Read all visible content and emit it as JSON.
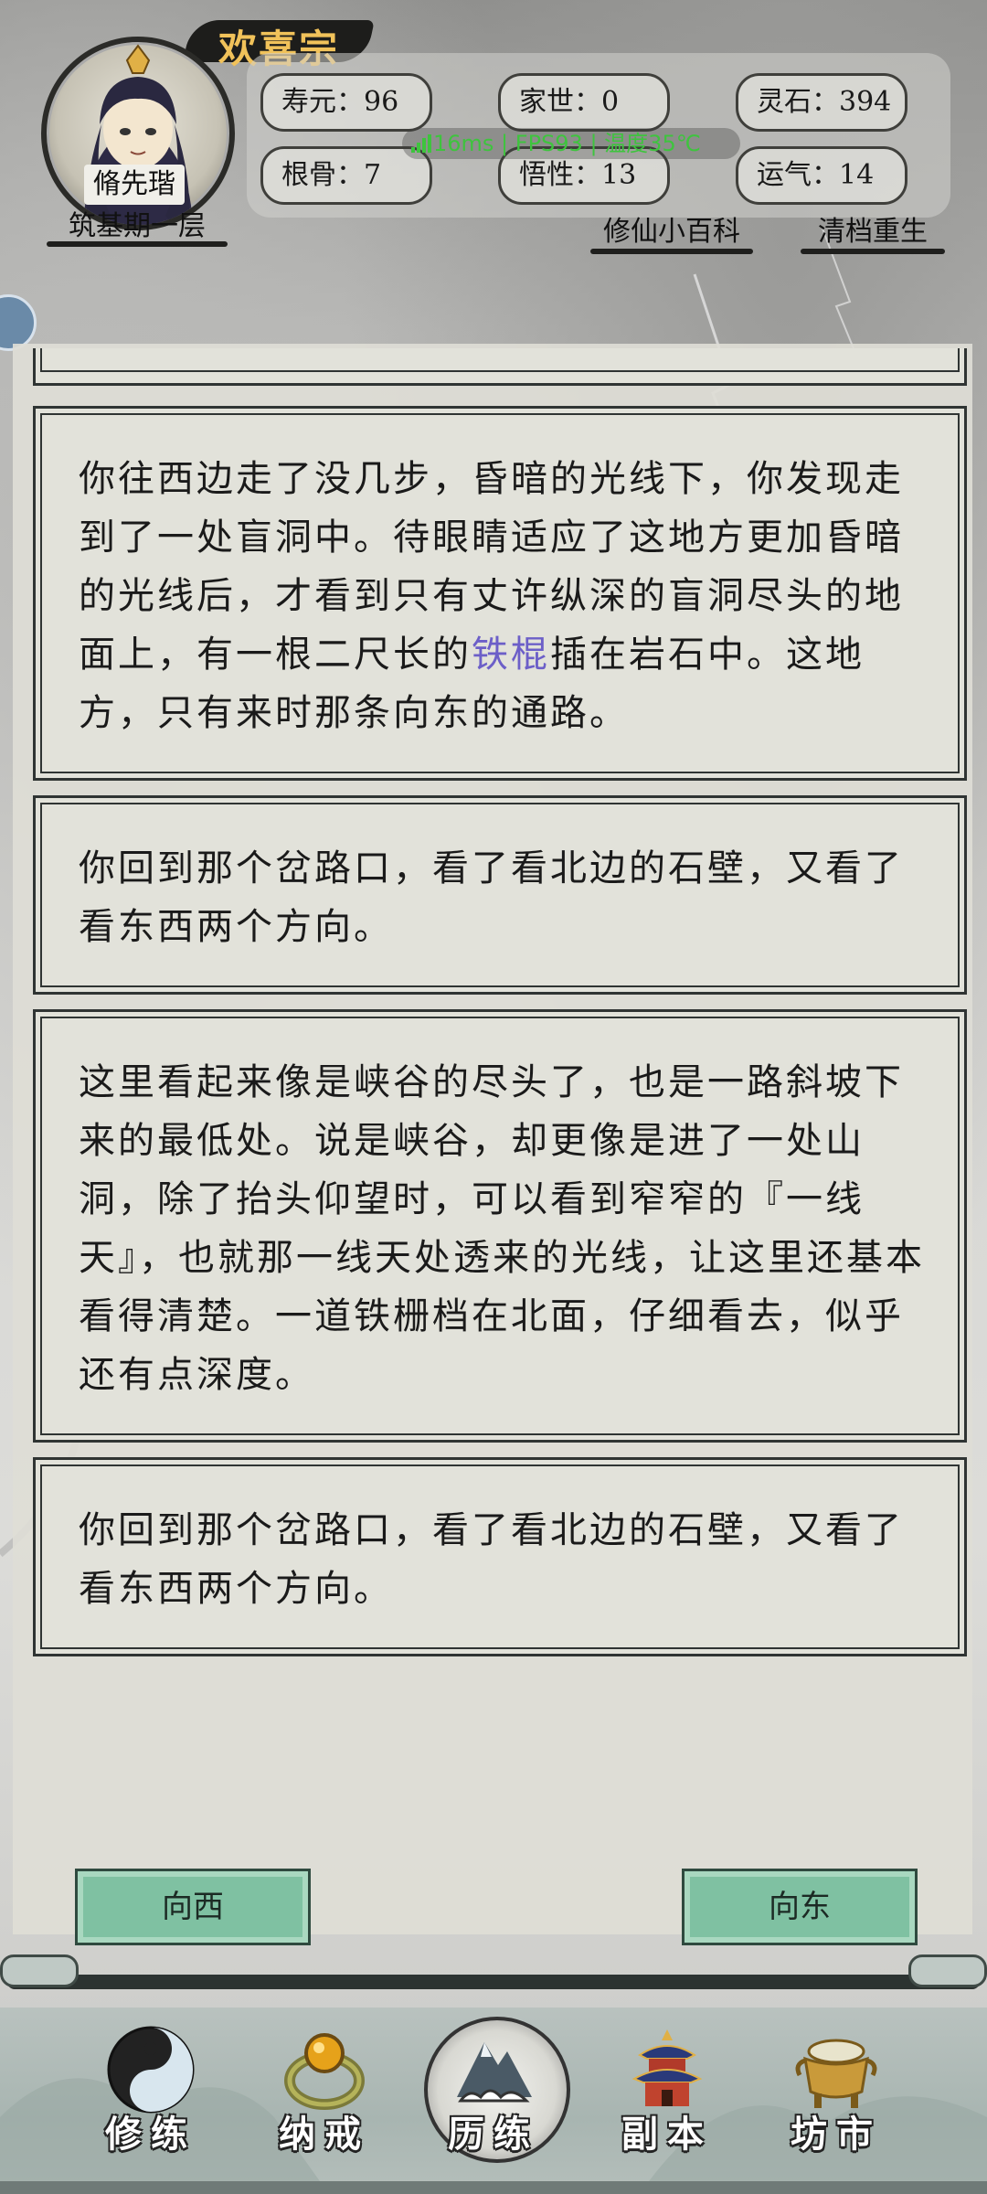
{
  "header": {
    "sect_name": "欢喜宗",
    "character_name": "脩先瑎",
    "realm": "筑基期一层",
    "stats": [
      {
        "label": "寿元",
        "value": "96"
      },
      {
        "label": "家世",
        "value": "0"
      },
      {
        "label": "灵石",
        "value": "394"
      },
      {
        "label": "根骨",
        "value": "7"
      },
      {
        "label": "悟性",
        "value": "13"
      },
      {
        "label": "运气",
        "value": "14"
      }
    ],
    "perf": {
      "latency": "16ms",
      "fps": "FPS93",
      "temp": "温度35℃"
    },
    "encyclopedia_label": "修仙小百科",
    "reset_label": "清档重生"
  },
  "log": {
    "entries": [
      {
        "pre": "你往西边走了没几步，昏暗的光线下，你发现走到了一处盲洞中。待眼睛适应了这地方更加昏暗的光线后，才看到只有丈许纵深的盲洞尽头的地面上，有一根二尺长的",
        "highlight": "铁棍",
        "post": "插在岩石中。这地方，只有来时那条向东的通路。"
      },
      {
        "text": "你回到那个岔路口，看了看北边的石壁，又看了看东西两个方向。"
      },
      {
        "text": "这里看起来像是峡谷的尽头了，也是一路斜坡下来的最低处。说是峡谷，却更像是进了一处山洞，除了抬头仰望时，可以看到窄窄的『一线天』，也就那一线天处透来的光线，让这里还基本看得清楚。一道铁栅档在北面，仔细看去，似乎还有点深度。"
      },
      {
        "text": "你回到那个岔路口，看了看北边的石壁，又看了看东西两个方向。"
      }
    ]
  },
  "actions": {
    "west": "向西",
    "east": "向东"
  },
  "nav": [
    {
      "label": "修练",
      "icon": "yin-yang-icon"
    },
    {
      "label": "纳戒",
      "icon": "ring-icon"
    },
    {
      "label": "历练",
      "icon": "mountain-cloud-icon",
      "active": true
    },
    {
      "label": "副本",
      "icon": "pagoda-icon"
    },
    {
      "label": "坊市",
      "icon": "cauldron-icon"
    }
  ],
  "colors": {
    "highlight_item": "#6c5fc8",
    "action_button": "#7fc1a2",
    "sect_name": "#f1c25a"
  }
}
